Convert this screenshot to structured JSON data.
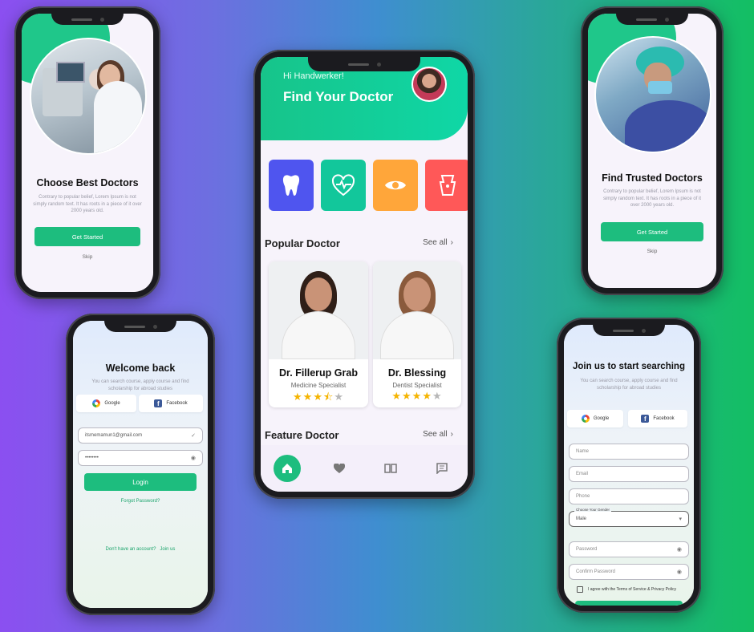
{
  "onboarding_left": {
    "title": "Choose Best Doctors",
    "description": "Contrary to popular belief, Lorem Ipsum is not simply random text. It has roots in a piece of it over 2000 years old.",
    "cta": "Get Started",
    "skip": "Skip"
  },
  "onboarding_right": {
    "title": "Find Trusted Doctors",
    "description": "Contrary to popular belief, Lorem Ipsum is not simply random text. It has roots in a piece of it over 2000 years old.",
    "cta": "Get Started",
    "skip": "Skip"
  },
  "login": {
    "title": "Welcome back",
    "description": "You can search course, apply course and find scholarship for abroad studies",
    "google": "Google",
    "facebook": "Facebook",
    "email_value": "itsmemamun1@gmail.com",
    "password_value": "••••••••",
    "login_button": "Login",
    "forgot": "Forgot Password?",
    "no_account": "Don't have an account?",
    "join": "Join us"
  },
  "signup": {
    "title": "Join us to start searching",
    "description": "You can search course, apply course and find scholarship for abroad studies",
    "google": "Google",
    "facebook": "Facebook",
    "name_ph": "Name",
    "email_ph": "Email",
    "phone_ph": "Phone",
    "gender_label": "Choose Your Gender",
    "gender_value": "Male",
    "password_ph": "Password",
    "confirm_ph": "Confirm Password",
    "agree": "I agree with the Terms of Service & Privacy Policy"
  },
  "home": {
    "greeting": "Hi Handwerker!",
    "title": "Find Your Doctor",
    "categories": [
      {
        "icon": "tooth-icon",
        "color": "#4f55ef"
      },
      {
        "icon": "heart-pulse-icon",
        "color": "#12c79b"
      },
      {
        "icon": "eye-icon",
        "color": "#ffa63a"
      },
      {
        "icon": "body-icon",
        "color": "#ff5858"
      }
    ],
    "popular_title": "Popular Doctor",
    "see_all": "See all",
    "doctors": [
      {
        "name": "Dr. Fillerup Grab",
        "specialty": "Medicine Specialist",
        "rating": 3.5
      },
      {
        "name": "Dr. Blessing",
        "specialty": "Dentist Specialist",
        "rating": 4
      }
    ],
    "feature_title": "Feature Doctor",
    "see_all_2": "See all"
  }
}
